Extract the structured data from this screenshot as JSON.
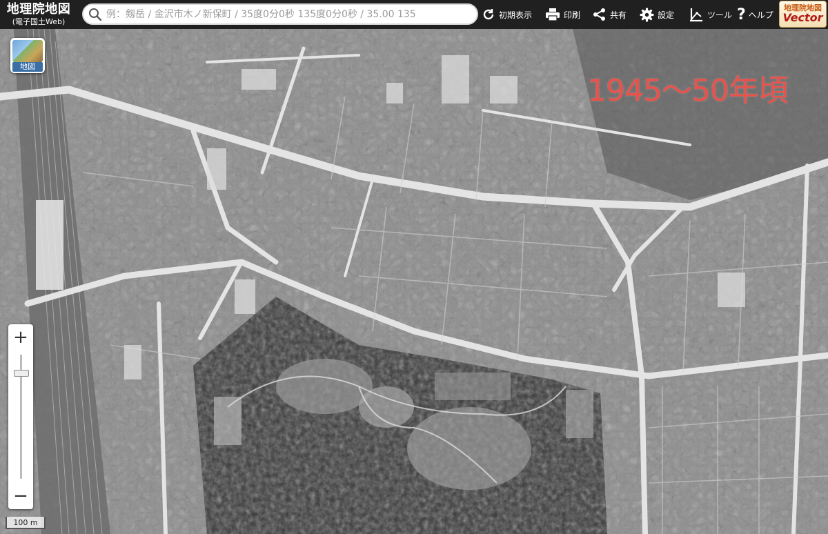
{
  "header": {
    "title": "地理院地図",
    "subtitle": "(電子国土Web)",
    "search_placeholder": "例：剱岳 / 金沢市木ノ新保町 / 35度0分0秒 135度0分0秒 / 35.00 135",
    "toolbar": {
      "reset": "初期表示",
      "print": "印刷",
      "share": "共有",
      "settings": "設定",
      "tools": "ツール",
      "help": "ヘルプ"
    },
    "vector": {
      "top": "地理院地図",
      "bottom": "Vector"
    }
  },
  "map": {
    "layer_button_label": "地図",
    "era_label": "1945〜50年頃",
    "era_color": "#e8524a",
    "zoom_in": "+",
    "zoom_out": "−",
    "zoom_level_fraction": 0.12,
    "scale_label": "100 m"
  }
}
